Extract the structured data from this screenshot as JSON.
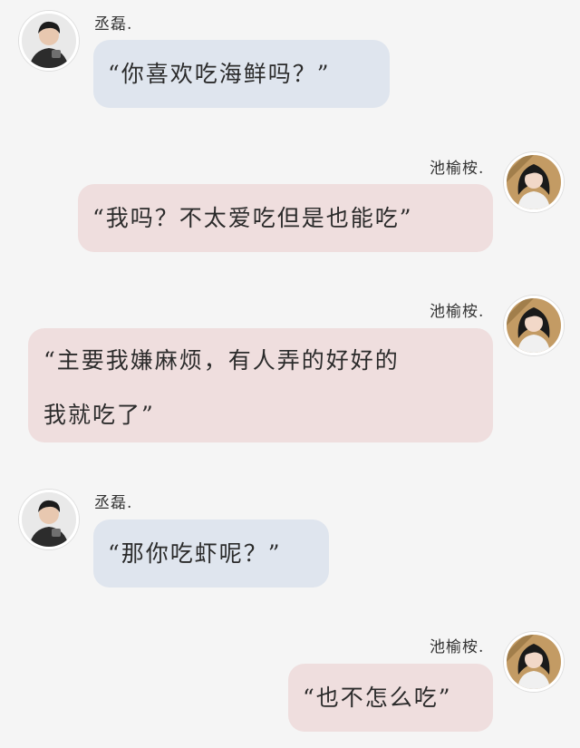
{
  "users": {
    "male": {
      "name": "丞磊.",
      "avatar_icon": "male-avatar-photo"
    },
    "female": {
      "name": "池榆桉.",
      "avatar_icon": "female-avatar-photo"
    }
  },
  "colors": {
    "background": "#f5f5f5",
    "left_bubble": "#dfe5ee",
    "right_bubble": "#efdede"
  },
  "messages": [
    {
      "sender": "丞磊.",
      "side": "left",
      "text": "“你喜欢吃海鲜吗？”"
    },
    {
      "sender": "池榆桉.",
      "side": "right",
      "text": "“我吗？不太爱吃但是也能吃”"
    },
    {
      "sender": "池榆桉.",
      "side": "right",
      "lines": [
        "“主要我嫌麻烦，有人弄的好好的",
        "我就吃了”"
      ]
    },
    {
      "sender": "丞磊.",
      "side": "left",
      "text": "“那你吃虾呢？”"
    },
    {
      "sender": "池榆桉.",
      "side": "right",
      "text": "“也不怎么吃”"
    }
  ]
}
